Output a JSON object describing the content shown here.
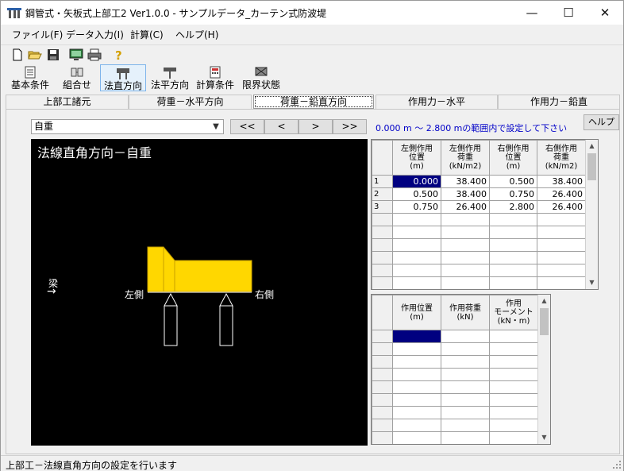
{
  "window": {
    "title": "鋼管式・矢板式上部工2 Ver1.0.0 - サンプルデータ_カーテン式防波堤",
    "minimize": "—",
    "maximize": "☐",
    "close": "✕"
  },
  "menu": [
    "ファイル(F)",
    "データ入力(I)",
    "計算(C)",
    "ヘルプ(H)"
  ],
  "toolbar_icons": [
    "new-file-icon",
    "open-folder-icon",
    "save-disk-icon",
    "calc-monitor-icon",
    "printer-icon",
    "help-question-icon"
  ],
  "big_toolbar": [
    {
      "label": "基本条件",
      "icon": "document-icon"
    },
    {
      "label": "組合せ",
      "icon": "combine-icon"
    },
    {
      "label": "法直方向",
      "icon": "vertical-load-icon",
      "active": true
    },
    {
      "label": "法平方向",
      "icon": "horizontal-load-icon"
    },
    {
      "label": "計算条件",
      "icon": "calc-condition-icon"
    },
    {
      "label": "限界状態",
      "icon": "limit-state-icon"
    }
  ],
  "tabs": [
    "上部工諸元",
    "荷重－水平方向",
    "荷重－鉛直方向",
    "作用力－水平",
    "作用力－鉛直"
  ],
  "active_tab": 2,
  "case_select": {
    "value": "自重"
  },
  "nav_buttons": [
    "<<",
    "<",
    ">",
    ">>"
  ],
  "range_text": "0.000 m 〜 2.800 mの範囲内で設定して下さい",
  "help_button": "ヘルプ",
  "canvas": {
    "title": "法線直角方向－自重",
    "beam_label": "梁",
    "arrow": "→",
    "left_label": "左側",
    "right_label": "右側",
    "colors": {
      "load": "#ffd700",
      "background": "#000000",
      "lines": "#ffffff"
    }
  },
  "load_table": {
    "headers": [
      [
        "左側作用",
        "位置",
        "(m)"
      ],
      [
        "左側作用",
        "荷重",
        "(kN/m2)"
      ],
      [
        "右側作用",
        "位置",
        "(m)"
      ],
      [
        "右側作用",
        "荷重",
        "(kN/m2)"
      ]
    ],
    "rows": [
      {
        "no": "1",
        "cells": [
          "0.000",
          "38.400",
          "0.500",
          "38.400"
        ]
      },
      {
        "no": "2",
        "cells": [
          "0.500",
          "38.400",
          "0.750",
          "26.400"
        ]
      },
      {
        "no": "3",
        "cells": [
          "0.750",
          "26.400",
          "2.800",
          "26.400"
        ]
      }
    ],
    "empty_rows": 7
  },
  "force_table": {
    "headers": [
      [
        "作用位置",
        "(m)"
      ],
      [
        "作用荷重",
        "(kN)"
      ],
      [
        "作用",
        "モーメント",
        "(kN・m)"
      ]
    ],
    "empty_rows": 9
  },
  "status": {
    "text": "上部工－法線直角方向の設定を行います"
  }
}
